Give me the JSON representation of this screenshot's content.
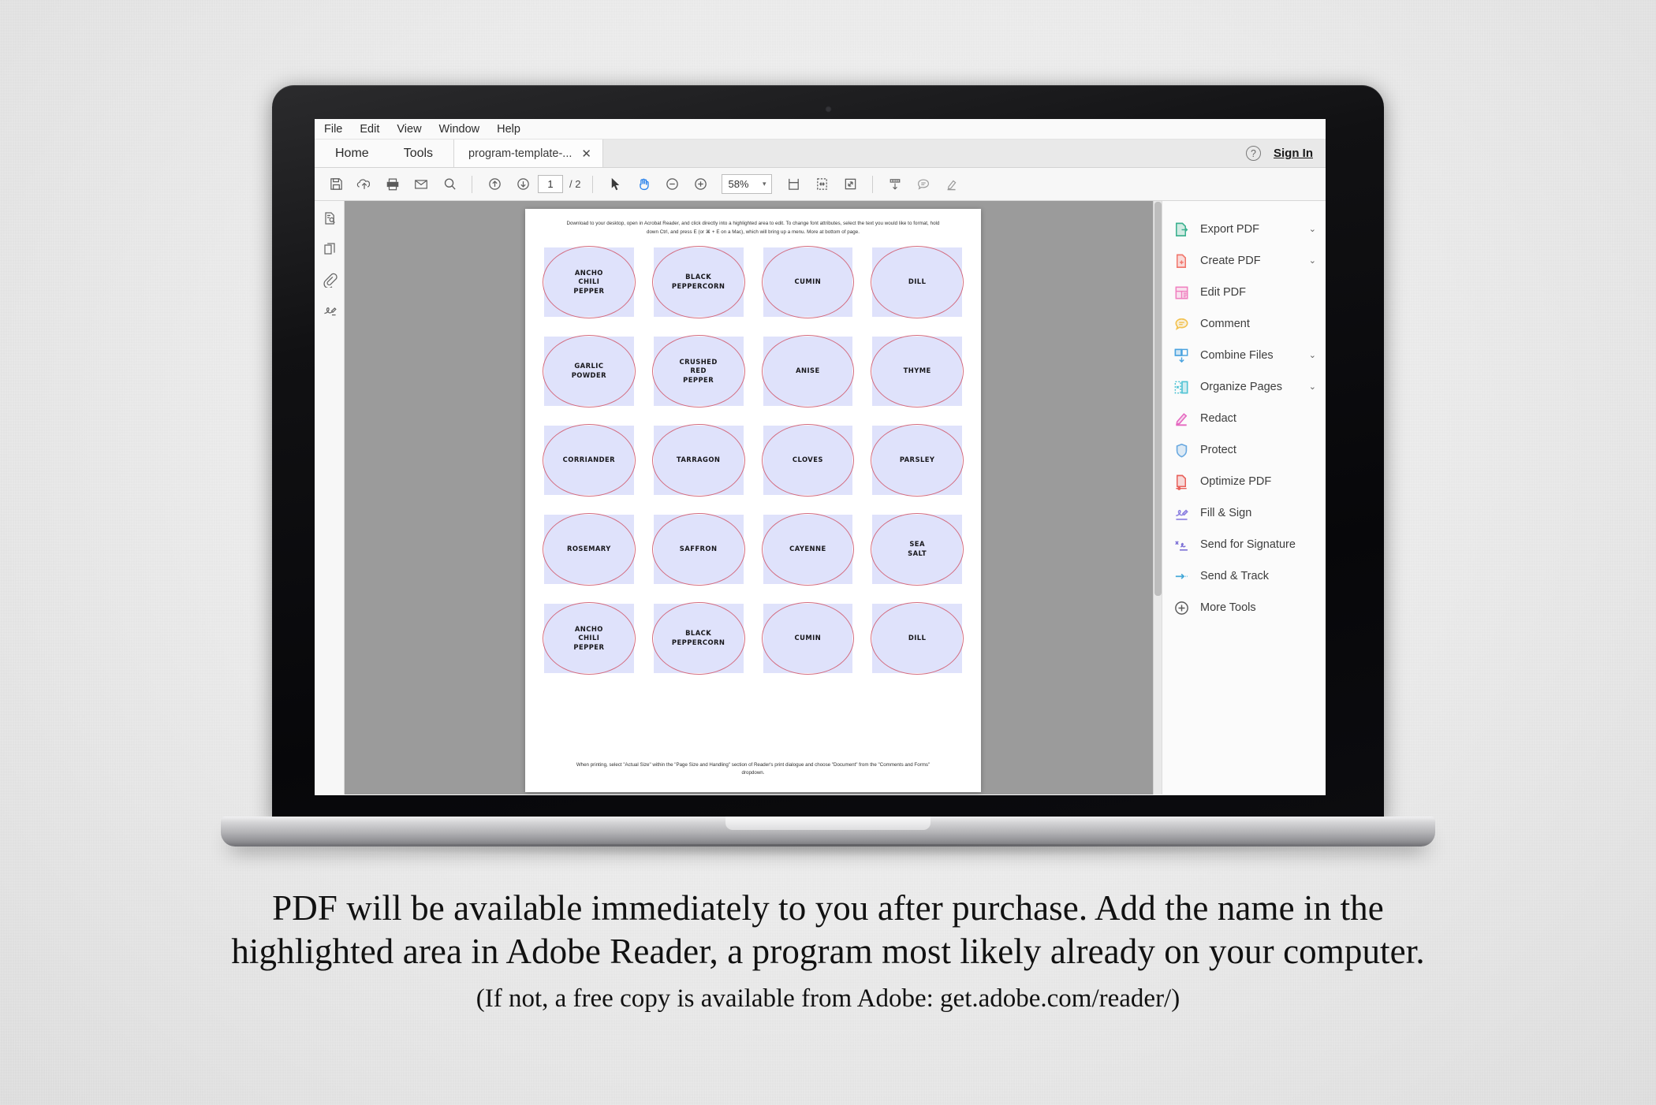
{
  "app": {
    "menubar": [
      "File",
      "Edit",
      "View",
      "Window",
      "Help"
    ],
    "home_label": "Home",
    "tools_label": "Tools",
    "tab_title": "program-template-...",
    "tab_close": "✕",
    "help_glyph": "?",
    "sign_in": "Sign In"
  },
  "toolbar": {
    "icons": [
      "save-icon",
      "upload-cloud-icon",
      "print-icon",
      "email-icon",
      "search-icon"
    ],
    "page_current": "1",
    "page_total": "/ 2",
    "select_tool": "cursor-arrow-icon",
    "pan_tool": "hand-icon",
    "zoom_out": "−",
    "zoom_in": "+",
    "zoom_value": "58%",
    "zoom_caret": "▾",
    "right_icons": [
      "fit-page-icon",
      "fit-width-icon",
      "fullscreen-icon",
      "fill-form-icon",
      "comment-icon",
      "highlight-icon"
    ]
  },
  "left_rail": {
    "items": [
      "thumbnails-icon",
      "page-thumbnails-icon",
      "attachment-clip-icon",
      "signature-icon"
    ],
    "collapse_glyph": "◀"
  },
  "pdf": {
    "note_top": "Download to your desktop, open in Acrobat Reader, and click directly into a highlighted area to edit. To change font attributes, select the text you would like to format, hold down Ctrl, and press E (or ⌘ + E on a Mac), which will bring up a menu.  More at bottom of page.",
    "note_bottom": "When printing, select \"Actual Size\" within the \"Page Size and Handling\" section of Reader's print dialogue and choose \"Document\" from the \"Comments and Forms\" dropdown.",
    "field_fill": "#dfe2fb",
    "circle_stroke": "#d36a7e",
    "labels": [
      "ANCHO\nCHILI\nPEPPER",
      "BLACK\nPEPPERCORN",
      "CUMIN",
      "DILL",
      "GARLIC\nPOWDER",
      "CRUSHED\nRED\nPEPPER",
      "ANISE",
      "THYME",
      "CORRIANDER",
      "TARRAGON",
      "CLOVES",
      "PARSLEY",
      "ROSEMARY",
      "SAFFRON",
      "CAYENNE",
      "SEA\nSALT",
      "ANCHO\nCHILI\nPEPPER",
      "BLACK\nPEPPERCORN",
      "CUMIN",
      "DILL"
    ]
  },
  "tool_pane": {
    "items": [
      {
        "label": "Export PDF",
        "icon": "export-pdf-icon",
        "color": "#3cb18f",
        "caret": "⌄"
      },
      {
        "label": "Create PDF",
        "icon": "create-pdf-icon",
        "color": "#f1756b",
        "caret": "⌄"
      },
      {
        "label": "Edit PDF",
        "icon": "edit-pdf-icon",
        "color": "#f080c0",
        "caret": ""
      },
      {
        "label": "Comment",
        "icon": "comment-icon",
        "color": "#f2c14e",
        "caret": ""
      },
      {
        "label": "Combine Files",
        "icon": "combine-files-icon",
        "color": "#4aa3df",
        "caret": "⌄"
      },
      {
        "label": "Organize Pages",
        "icon": "organize-pages-icon",
        "color": "#4fc3d4",
        "caret": "⌄"
      },
      {
        "label": "Redact",
        "icon": "redact-icon",
        "color": "#e568c0",
        "caret": ""
      },
      {
        "label": "Protect",
        "icon": "protect-shield-icon",
        "color": "#6aa9e0",
        "caret": ""
      },
      {
        "label": "Optimize PDF",
        "icon": "optimize-pdf-icon",
        "color": "#e8605a",
        "caret": ""
      },
      {
        "label": "Fill & Sign",
        "icon": "fill-sign-icon",
        "color": "#8a7ee0",
        "caret": ""
      },
      {
        "label": "Send for Signature",
        "icon": "send-signature-icon",
        "color": "#7b6fd6",
        "caret": ""
      },
      {
        "label": "Send & Track",
        "icon": "send-track-icon",
        "color": "#44a8d8",
        "caret": ""
      },
      {
        "label": "More Tools",
        "icon": "more-tools-plus-icon",
        "color": "#5a5a5a",
        "caret": ""
      }
    ]
  },
  "caption": {
    "line1": "PDF will be available immediately to you after purchase.  Add the name in the",
    "line2": "highlighted area in Adobe Reader, a program most likely already on your computer.",
    "line3": "(If not, a free copy is available from Adobe: get.adobe.com/reader/)"
  }
}
